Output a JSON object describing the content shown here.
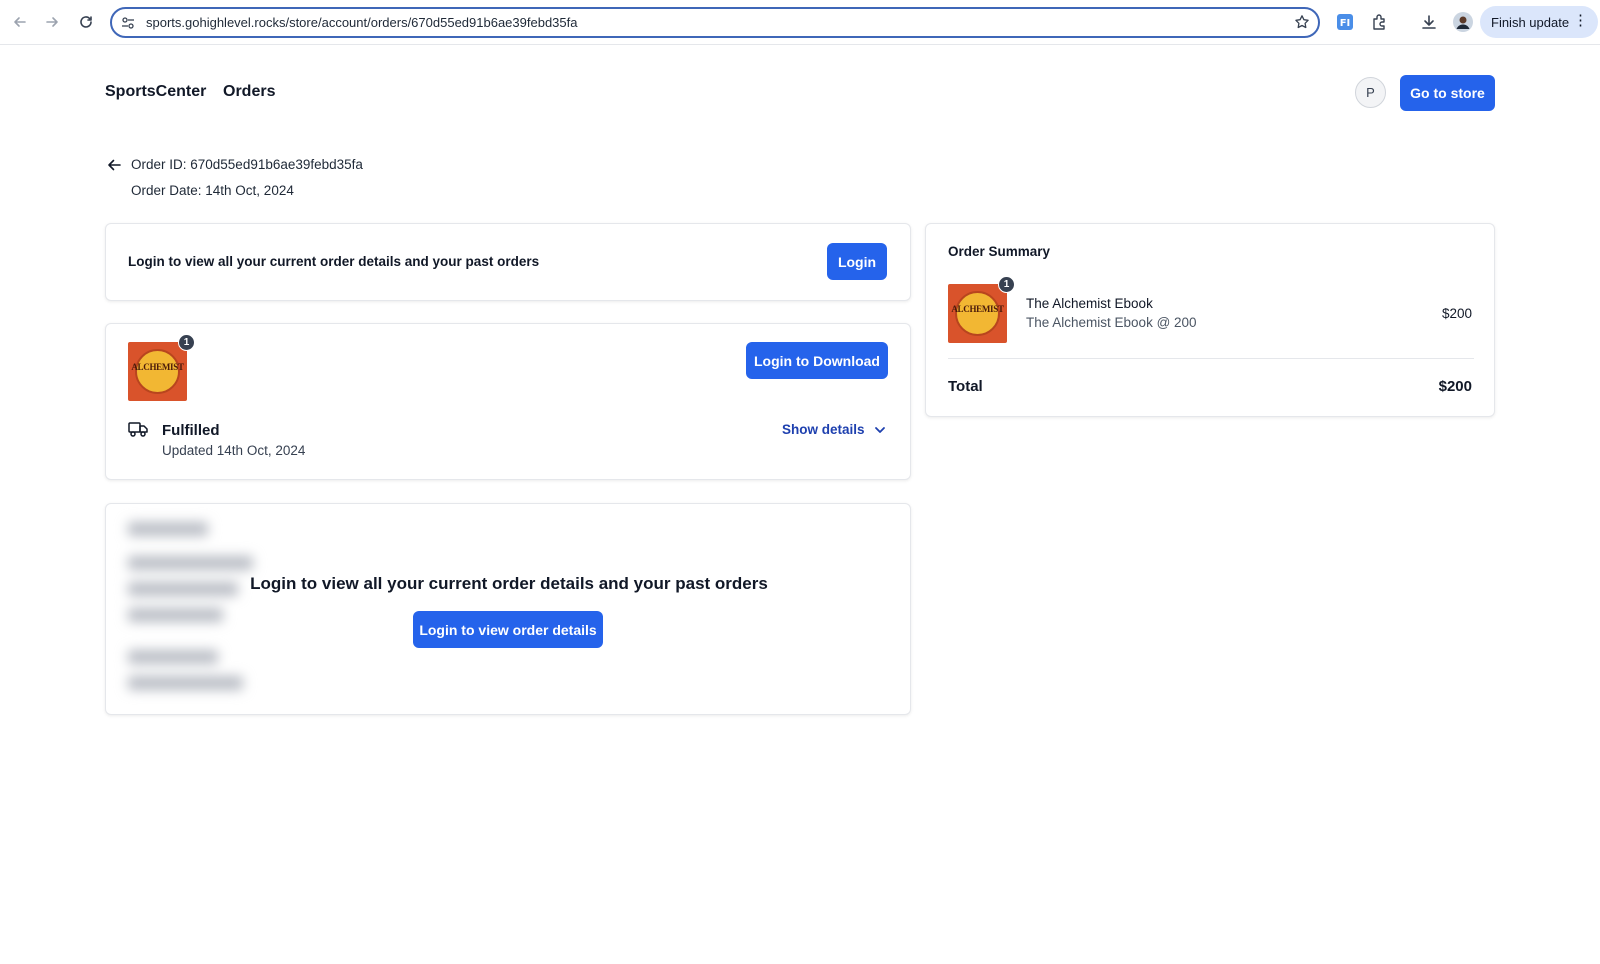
{
  "browser": {
    "url": "sports.gohighlevel.rocks/store/account/orders/670d55ed91b6ae39febd35fa",
    "finish_update": "Finish update"
  },
  "header": {
    "brand": "SportsCenter",
    "nav_orders": "Orders",
    "avatar_initial": "P",
    "go_to_store": "Go to store"
  },
  "order": {
    "id_text": "Order ID: 670d55ed91b6ae39febd35fa",
    "date_text": "Order Date: 14th Oct, 2024"
  },
  "login_card": {
    "message": "Login to view all your current order details and your past orders",
    "button": "Login"
  },
  "item_card": {
    "quantity": "1",
    "download_button": "Login to Download",
    "status": "Fulfilled",
    "updated": "Updated 14th Oct, 2024",
    "show_details": "Show details"
  },
  "blur_card": {
    "message": "Login to view all your current order details and your past orders",
    "button": "Login to view order details"
  },
  "summary": {
    "title": "Order Summary",
    "quantity": "1",
    "item_name": "The Alchemist Ebook",
    "item_variant": "The Alchemist Ebook @ 200",
    "item_price": "$200",
    "total_label": "Total",
    "total_value": "$200"
  },
  "colors": {
    "primary": "#2563eb",
    "link": "#1e40af",
    "book_cover": "#d9532b"
  }
}
